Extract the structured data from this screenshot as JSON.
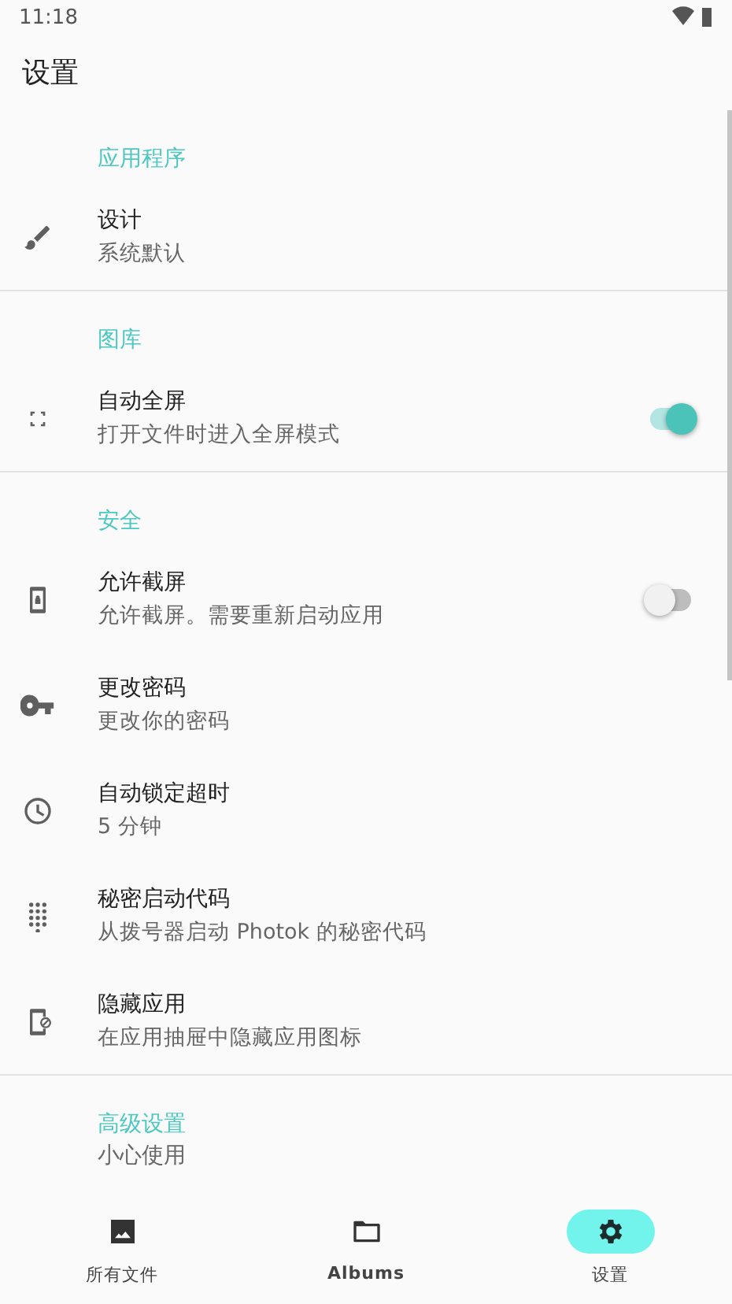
{
  "status_bar": {
    "time": "11:18"
  },
  "title": "设置",
  "sections": [
    {
      "title": "应用程序",
      "items": [
        {
          "kind": "plain",
          "title": "设计",
          "summary": "系统默认"
        }
      ]
    },
    {
      "title": "图库",
      "items": [
        {
          "kind": "toggle",
          "title": "自动全屏",
          "summary": "打开文件时进入全屏模式",
          "on": true
        }
      ]
    },
    {
      "title": "安全",
      "items": [
        {
          "kind": "toggle",
          "title": "允许截屏",
          "summary": "允许截屏。需要重新启动应用",
          "on": false
        },
        {
          "kind": "plain",
          "title": "更改密码",
          "summary": "更改你的密码"
        },
        {
          "kind": "plain",
          "title": "自动锁定超时",
          "summary": "5 分钟"
        },
        {
          "kind": "plain",
          "title": "秘密启动代码",
          "summary": "从拨号器启动 Photok 的秘密代码"
        },
        {
          "kind": "plain",
          "title": "隐藏应用",
          "summary": "在应用抽屉中隐藏应用图标"
        }
      ]
    },
    {
      "title": "高级设置",
      "summary": "小心使用"
    }
  ],
  "nav": [
    {
      "label": "所有文件",
      "selected": false
    },
    {
      "label": "Albums",
      "selected": false
    },
    {
      "label": "设置",
      "selected": true
    }
  ]
}
